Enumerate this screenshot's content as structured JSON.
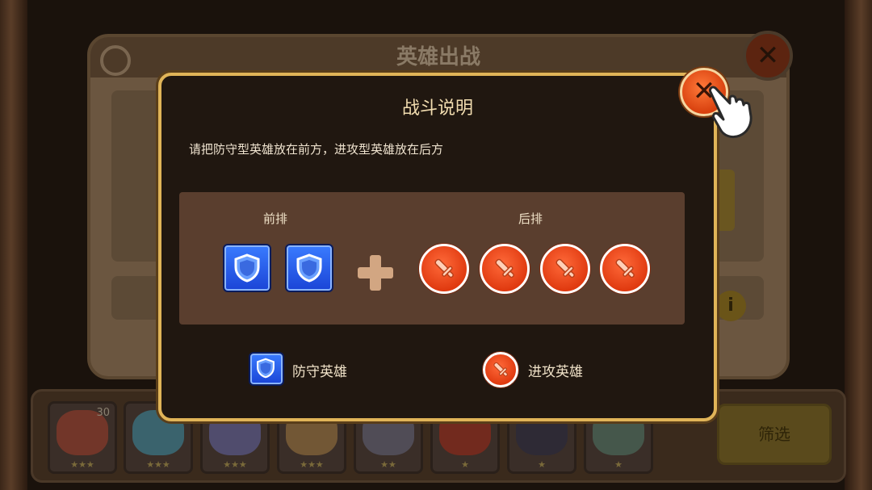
{
  "background_window": {
    "title": "英雄出战"
  },
  "hero_bar": {
    "heroes": [
      {
        "level": "30",
        "stars": "★★★",
        "color": "#8a3a2a"
      },
      {
        "level": "",
        "stars": "★★★",
        "color": "#3a7a8a"
      },
      {
        "level": "",
        "stars": "★★★",
        "color": "#5a5a8a"
      },
      {
        "level": "",
        "stars": "★★★",
        "color": "#8a6a3a"
      },
      {
        "level": "",
        "stars": "★★",
        "color": "#5a5a6a"
      },
      {
        "level": "",
        "stars": "★",
        "color": "#8a2a1a"
      },
      {
        "level": "",
        "stars": "★",
        "color": "#2a2a3a"
      },
      {
        "level": "",
        "stars": "★",
        "color": "#4a6a5a"
      }
    ],
    "filter_label": "筛选"
  },
  "modal": {
    "title": "战斗说明",
    "description": "请把防守型英雄放在前方，进攻型英雄放在后方",
    "front_row_label": "前排",
    "back_row_label": "后排",
    "front_row_icons": [
      "shield-icon",
      "shield-icon"
    ],
    "back_row_icons": [
      "sword-icon",
      "sword-icon",
      "sword-icon",
      "sword-icon"
    ],
    "legend": {
      "defense_label": "防守英雄",
      "attack_label": "进攻英雄"
    },
    "close_icon": "close-icon"
  },
  "colors": {
    "modal_border": "#e0b458",
    "defense_blue": "#2a5cf0",
    "attack_orange": "#e84a1a"
  }
}
